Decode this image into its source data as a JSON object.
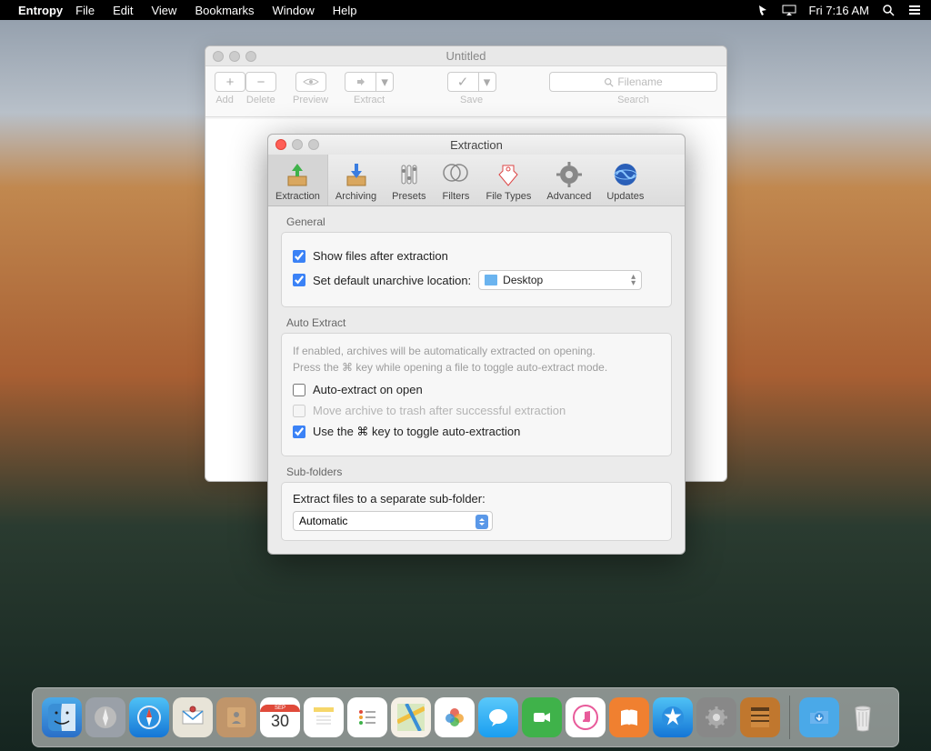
{
  "menubar": {
    "app_name": "Entropy",
    "items": [
      "File",
      "Edit",
      "View",
      "Bookmarks",
      "Window",
      "Help"
    ],
    "clock": "Fri 7:16 AM"
  },
  "back_window": {
    "title": "Untitled",
    "toolbar": {
      "add": "Add",
      "delete": "Delete",
      "preview": "Preview",
      "extract": "Extract",
      "save": "Save",
      "search_placeholder": "Filename",
      "search_label": "Search"
    }
  },
  "prefs": {
    "title": "Extraction",
    "tabs": [
      {
        "label": "Extraction"
      },
      {
        "label": "Archiving"
      },
      {
        "label": "Presets"
      },
      {
        "label": "Filters"
      },
      {
        "label": "File Types"
      },
      {
        "label": "Advanced"
      },
      {
        "label": "Updates"
      }
    ],
    "general": {
      "title": "General",
      "show_files": "Show files after extraction",
      "show_files_checked": true,
      "set_default": "Set default unarchive location:",
      "set_default_checked": true,
      "location_value": "Desktop"
    },
    "auto_extract": {
      "title": "Auto Extract",
      "hint1": "If enabled, archives will be automatically extracted on opening.",
      "hint2": "Press the ⌘ key while opening a file to toggle auto-extract mode.",
      "opt1": "Auto-extract on open",
      "opt1_checked": false,
      "opt2": "Move archive to trash after successful extraction",
      "opt2_checked": false,
      "opt3": "Use the ⌘ key to toggle auto-extraction",
      "opt3_checked": true
    },
    "subfolders": {
      "title": "Sub-folders",
      "label": "Extract files to a separate sub-folder:",
      "value": "Automatic"
    }
  },
  "dock": {
    "items": [
      "finder",
      "launchpad",
      "safari",
      "mail",
      "contacts",
      "calendar",
      "notes",
      "reminders",
      "maps",
      "photos",
      "messages",
      "facetime",
      "itunes",
      "ibooks",
      "appstore",
      "preferences",
      "entropy"
    ],
    "calendar_day": "30",
    "right_items": [
      "downloads",
      "trash"
    ]
  }
}
